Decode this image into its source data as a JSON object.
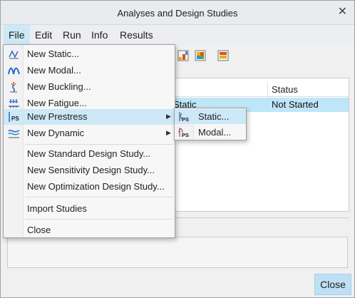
{
  "window": {
    "title": "Analyses and Design Studies",
    "close_glyph": "✕"
  },
  "menubar": {
    "items": [
      "File",
      "Edit",
      "Run",
      "Info",
      "Results"
    ]
  },
  "table": {
    "columns": [
      "",
      "Status"
    ],
    "rows": [
      {
        "type": "Static",
        "status": "Not Started"
      }
    ]
  },
  "file_menu": {
    "items": [
      {
        "label": "New Static...",
        "icon": "static-analysis-icon"
      },
      {
        "label": "New Modal...",
        "icon": "modal-analysis-icon"
      },
      {
        "label": "New Buckling...",
        "icon": "buckling-analysis-icon"
      },
      {
        "label": "New Fatigue...",
        "icon": "fatigue-analysis-icon"
      },
      {
        "label": "New Prestress",
        "icon": "prestress-analysis-icon",
        "has_submenu": true
      },
      {
        "label": "New Dynamic",
        "icon": "dynamic-analysis-icon",
        "has_submenu": true
      },
      {
        "label": "New Standard Design Study..."
      },
      {
        "label": "New Sensitivity Design Study..."
      },
      {
        "label": "New Optimization Design Study..."
      },
      {
        "label": "Import Studies"
      },
      {
        "label": "Close"
      }
    ]
  },
  "prestress_submenu": {
    "items": [
      {
        "label": "Static...",
        "icon": "prestress-static-icon"
      },
      {
        "label": "Modal...",
        "icon": "prestress-modal-icon"
      }
    ],
    "icon_text": "PS"
  },
  "footer": {
    "close_label": "Close"
  },
  "colors": {
    "highlight": "#cde8f7",
    "selected_row": "#bfe6f8",
    "close_button": "#bfe0f4"
  }
}
